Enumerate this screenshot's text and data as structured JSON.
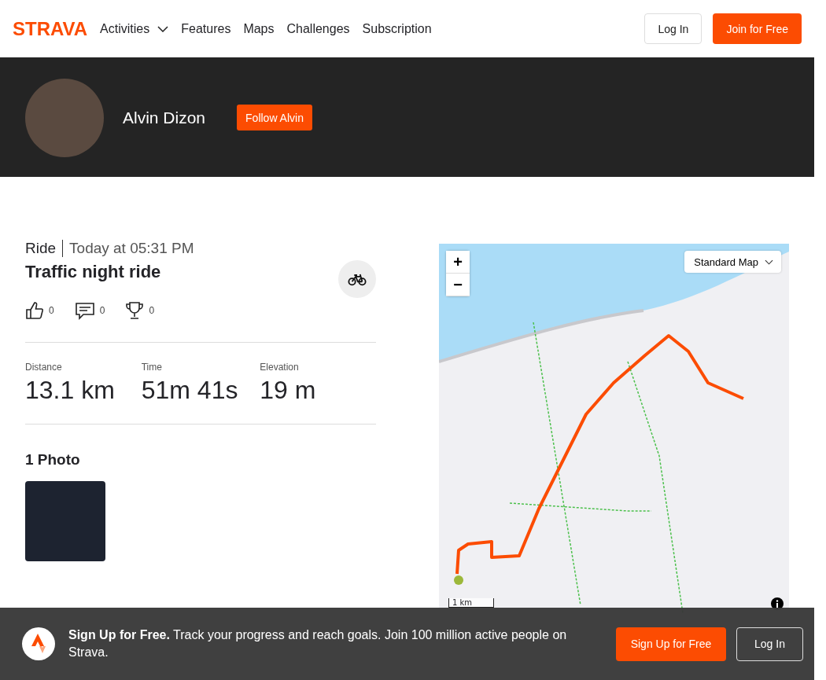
{
  "header": {
    "logo": "STRAVA",
    "nav": [
      {
        "label": "Activities",
        "dropdown": true
      },
      {
        "label": "Features",
        "dropdown": false
      },
      {
        "label": "Maps",
        "dropdown": false
      },
      {
        "label": "Challenges",
        "dropdown": false
      },
      {
        "label": "Subscription",
        "dropdown": false
      }
    ],
    "login": "Log In",
    "join": "Join for Free"
  },
  "athlete": {
    "name": "Alvin Dizon",
    "follow": "Follow Alvin"
  },
  "activity": {
    "type": "Ride",
    "when": "Today at 05:31 PM",
    "title": "Traffic night ride",
    "kudos": "0",
    "comments": "0",
    "achievements": "0",
    "stats": [
      {
        "label": "Distance",
        "value": "13.1 km"
      },
      {
        "label": "Time",
        "value": "51m 41s"
      },
      {
        "label": "Elevation",
        "value": "19 m"
      }
    ],
    "photos_heading": "1 Photo"
  },
  "map": {
    "style": "Standard Map",
    "zoom_in": "+",
    "zoom_out": "−",
    "scale": "1 km"
  },
  "banner": {
    "text": "**Sign Up for Free.** Track your progress and reach goals. Join 100 million active people on Strava.",
    "signup": "Sign Up for Free",
    "login": "Log In"
  }
}
